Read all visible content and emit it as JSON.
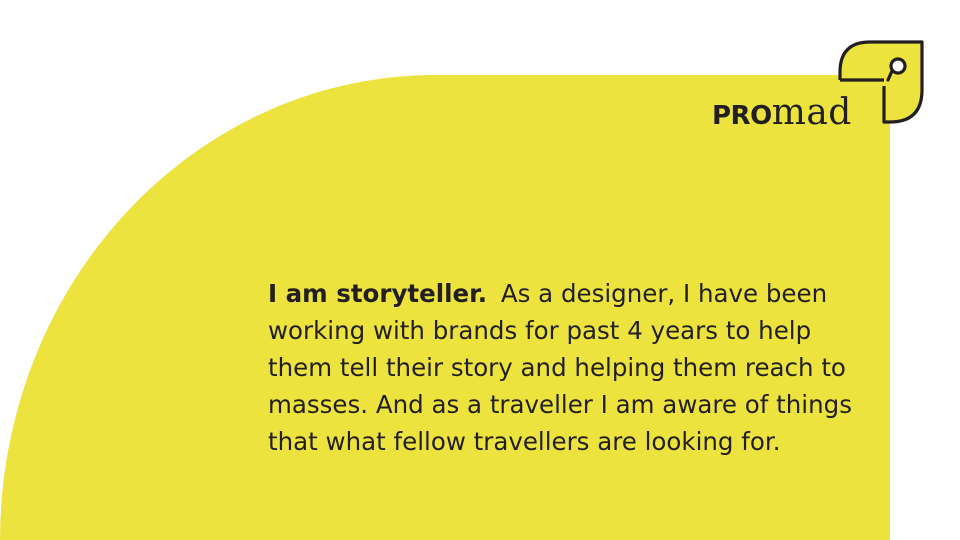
{
  "brand": {
    "prefix": "PRO",
    "suffix": "mad"
  },
  "bio": {
    "lead": "I am storyteller.",
    "text": "As a designer, I have been working with brands for past 4 years to help them tell their story and helping them reach to masses. And as a traveller I am aware of things that what fellow travellers are looking for."
  },
  "colors": {
    "accent": "#ece33e",
    "text": "#231f20",
    "background": "#ffffff"
  }
}
